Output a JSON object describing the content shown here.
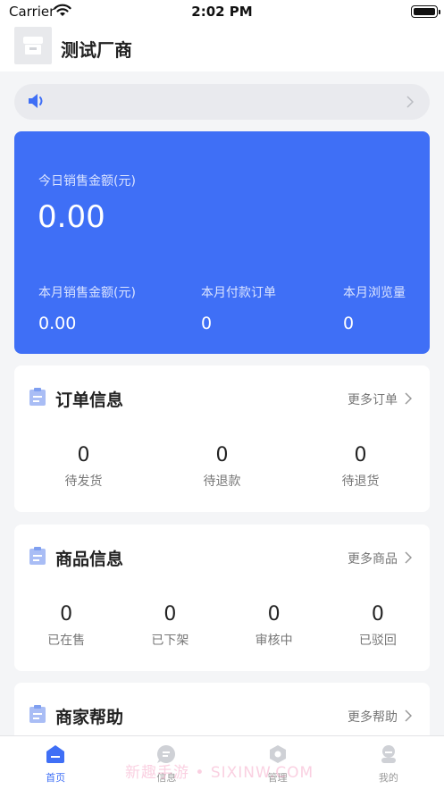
{
  "status_bar": {
    "carrier": "Carrier",
    "time": "2:02 PM"
  },
  "header": {
    "title": "测试厂商",
    "logo_icon": "store-icon"
  },
  "notice": {
    "icon": "speaker-icon",
    "text": ""
  },
  "sales": {
    "today_label": "今日销售金额(元)",
    "today_value": "0.00",
    "stats": [
      {
        "label": "本月销售金额(元)",
        "value": "0.00"
      },
      {
        "label": "本月付款订单",
        "value": "0"
      },
      {
        "label": "本月浏览量",
        "value": "0"
      }
    ]
  },
  "orders": {
    "title": "订单信息",
    "more": "更多订单",
    "stats": [
      {
        "value": "0",
        "label": "待发货"
      },
      {
        "value": "0",
        "label": "待退款"
      },
      {
        "value": "0",
        "label": "待退货"
      }
    ]
  },
  "products": {
    "title": "商品信息",
    "more": "更多商品",
    "stats": [
      {
        "value": "0",
        "label": "已在售"
      },
      {
        "value": "0",
        "label": "已下架"
      },
      {
        "value": "0",
        "label": "审核中"
      },
      {
        "value": "0",
        "label": "已驳回"
      }
    ]
  },
  "help": {
    "title": "商家帮助",
    "more": "更多帮助"
  },
  "tabbar": {
    "items": [
      {
        "label": "首页",
        "icon": "home-icon",
        "active": true
      },
      {
        "label": "信息",
        "icon": "message-icon",
        "active": false
      },
      {
        "label": "管理",
        "icon": "manage-icon",
        "active": false
      },
      {
        "label": "我的",
        "icon": "profile-icon",
        "active": false
      }
    ]
  },
  "watermark": "新趣手游 • SIXINW.COM",
  "colors": {
    "accent": "#3f6ff6",
    "background": "#f4f5f7",
    "section_icon": "#a9bdf5"
  }
}
